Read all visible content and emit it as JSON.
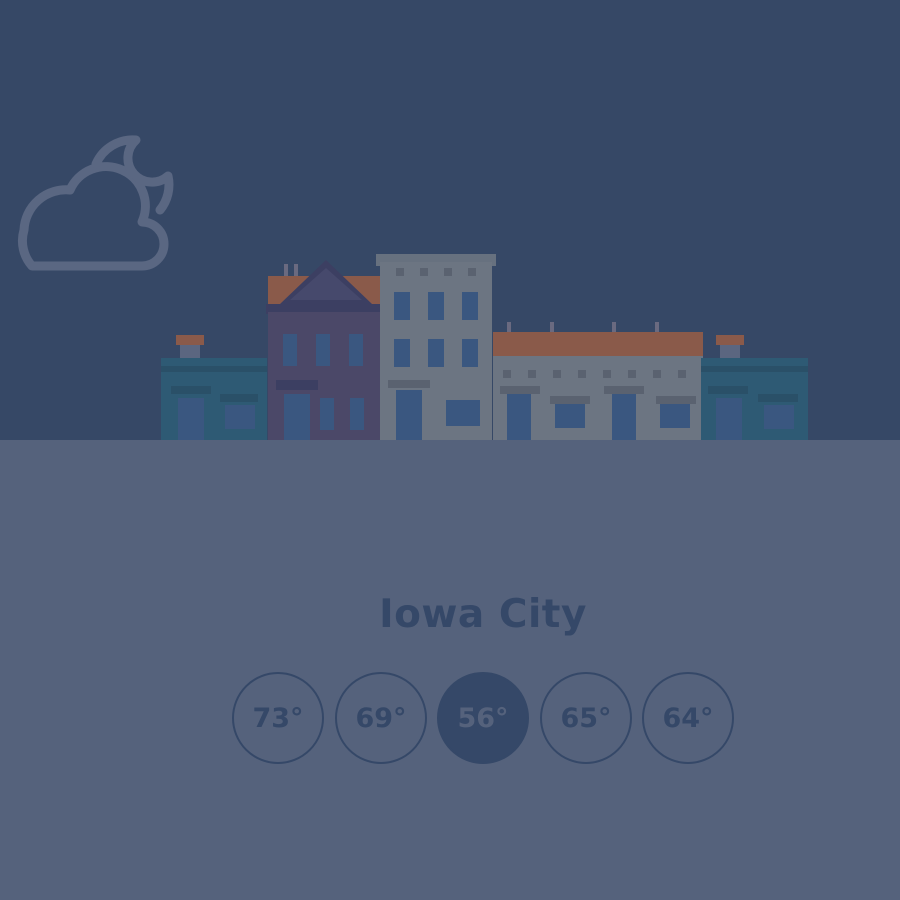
{
  "location": {
    "city": "Iowa City"
  },
  "weather": {
    "icon": "partly-cloudy-night-icon"
  },
  "forecast": {
    "selected_index": 2,
    "temps": [
      {
        "label": "73°"
      },
      {
        "label": "69°"
      },
      {
        "label": "56°"
      },
      {
        "label": "65°"
      },
      {
        "label": "64°"
      }
    ]
  },
  "colors": {
    "sky": "#364866",
    "ground": "#55627c",
    "accent": "#354868",
    "icon_stroke": "#5a6782"
  }
}
